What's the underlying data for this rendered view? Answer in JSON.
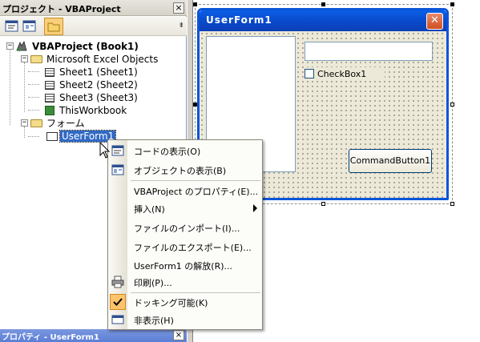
{
  "project_explorer": {
    "title": "プロジェクト - VBAProject",
    "close_glyph": "×",
    "toolbar": {
      "view_code_icon": "code-view-icon",
      "view_object_icon": "form-view-icon",
      "toggle_folders_icon": "folder-icon",
      "overflow_glyph": "⇟"
    },
    "tree": {
      "project": "VBAProject (Book1)",
      "excel_objects_folder": "Microsoft Excel Objects",
      "sheets": [
        "Sheet1 (Sheet1)",
        "Sheet2 (Sheet2)",
        "Sheet3 (Sheet3)"
      ],
      "workbook": "ThisWorkbook",
      "forms_folder": "フォーム",
      "userform": "UserForm1",
      "expander_open": "−"
    }
  },
  "properties_panel": {
    "title": "プロパティ - UserForm1",
    "close_glyph": "×"
  },
  "userform_designer": {
    "title": "UserForm1",
    "close_glyph": "✕",
    "checkbox_label": "CheckBox1",
    "command_button_label": "CommandButton1"
  },
  "context_menu": {
    "items": [
      {
        "label": "コードの表示(O)",
        "icon": "code-view-icon"
      },
      {
        "label": "オブジェクトの表示(B)",
        "icon": "form-view-icon"
      },
      {
        "label": "VBAProject のプロパティ(E)...",
        "icon": ""
      },
      {
        "label": "挿入(N)",
        "icon": "",
        "submenu": true
      },
      {
        "label": "ファイルのインポート(I)...",
        "icon": ""
      },
      {
        "label": "ファイルのエクスポート(E)...",
        "icon": ""
      },
      {
        "label": "UserForm1 の解放(R)...",
        "icon": ""
      },
      {
        "label": "印刷(P)...",
        "icon": "printer-icon"
      },
      {
        "label": "ドッキング可能(K)",
        "icon": "checkmark-icon",
        "checked": true
      },
      {
        "label": "非表示(H)",
        "icon": "hide-window-icon"
      }
    ]
  },
  "colors": {
    "selection": "#316ac5",
    "userform_border": "#0a55d8",
    "menu_check_highlight": "#fdc46c"
  }
}
